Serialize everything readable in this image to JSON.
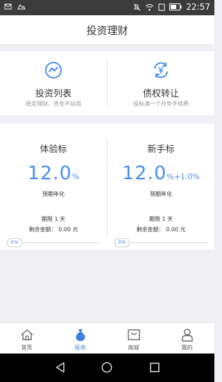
{
  "status_bar": {
    "time": "22:57",
    "icons": [
      "notification-icon",
      "image-icon",
      "mute-icon",
      "wifi-icon",
      "sim-icon",
      "battery-icon"
    ]
  },
  "header": {
    "title": "投资理财"
  },
  "nav_cards": [
    {
      "title": "投资列表",
      "subtitle": "稳定理财，资金不站岗",
      "icon": "chart-circle-icon"
    },
    {
      "title": "债权转让",
      "subtitle": "投标满一个月免手续费",
      "icon": "transfer-yen-icon"
    }
  ],
  "products": [
    {
      "name": "体验标",
      "rate": "12.0",
      "rate_unit": "%",
      "rate_bonus": "",
      "rate_label": "预期年化",
      "term": "期限 1 天",
      "remaining": "剩余金额：  0.00 元",
      "progress_text": "0%",
      "progress": 0
    },
    {
      "name": "新手标",
      "rate": "12.0",
      "rate_unit": "%",
      "rate_bonus": "+1.0%",
      "rate_label": "预期年化",
      "term": "期限 1 天",
      "remaining": "剩余金额：  0.00 元",
      "progress_text": "0%",
      "progress": 0
    }
  ],
  "tabbar": {
    "active": "invest",
    "items": [
      {
        "key": "home",
        "label": "首页",
        "icon": "home-icon"
      },
      {
        "key": "invest",
        "label": "投资",
        "icon": "money-bag-icon"
      },
      {
        "key": "mall",
        "label": "商城",
        "icon": "shop-icon"
      },
      {
        "key": "mine",
        "label": "我的",
        "icon": "person-icon"
      }
    ]
  },
  "colors": {
    "accent": "#4a8ef2",
    "active_tab": "#3c7fe0",
    "status_bar": "#3b3b3b"
  }
}
